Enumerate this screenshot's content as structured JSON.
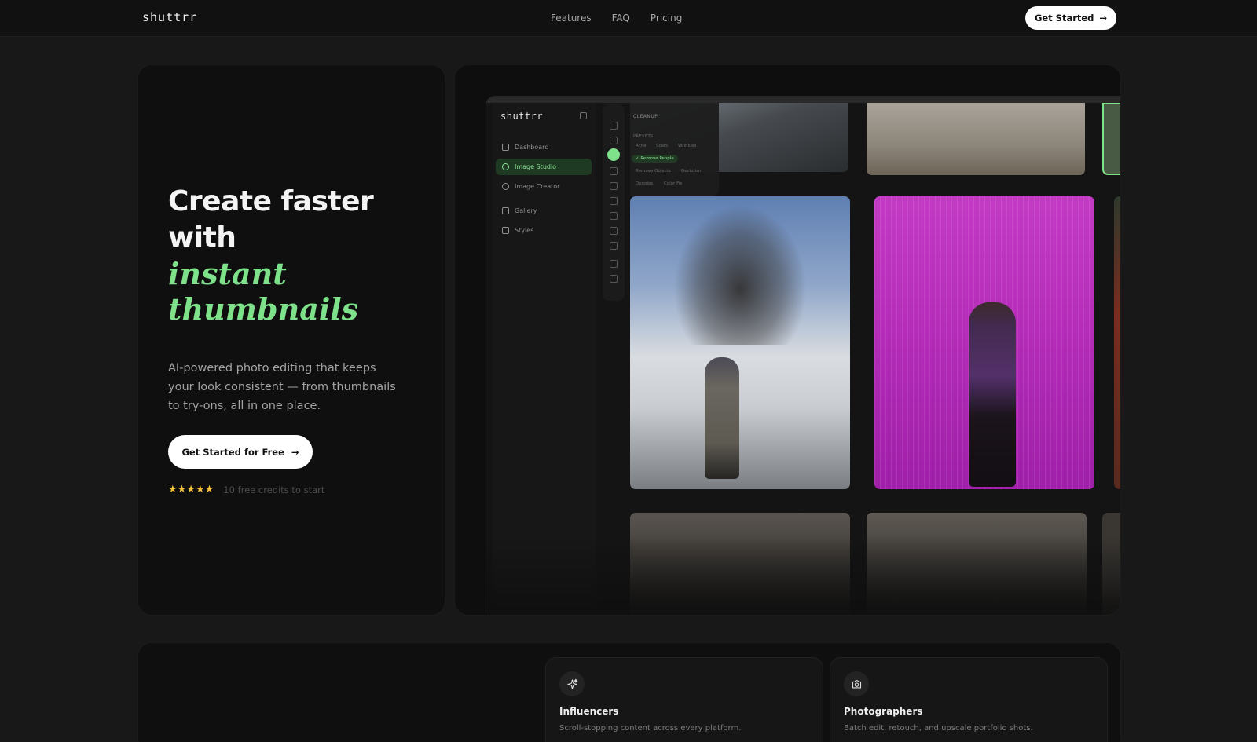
{
  "header": {
    "logo": "shuttrr",
    "nav": [
      "Features",
      "FAQ",
      "Pricing"
    ],
    "cta": "Get Started"
  },
  "hero": {
    "title": "Create faster with",
    "accent": "instant thumbnails",
    "subtitle": "AI-powered photo editing that keeps your look consistent — from thumbnails to try-ons, all in one place.",
    "cta": "Get Started for Free",
    "stars": "★★★★★",
    "credits": "10 free credits to start"
  },
  "app": {
    "logo": "shuttrr",
    "nav": [
      {
        "label": "Dashboard"
      },
      {
        "label": "Image Studio",
        "active": true
      },
      {
        "label": "Image Creator"
      },
      {
        "label": "Gallery"
      },
      {
        "label": "Styles"
      }
    ],
    "panel": {
      "heading": "CLEANUP",
      "presets_label": "PRESETS",
      "chips": [
        "Acne",
        "Scars",
        "Wrinkles",
        "✓ Remove People",
        "Remove Objects",
        "Declutter",
        "Denoise",
        "Color Fix"
      ]
    }
  },
  "features": [
    {
      "icon": "sparkle-icon",
      "title": "Influencers",
      "desc": "Scroll-stopping content across every platform."
    },
    {
      "icon": "camera-icon",
      "title": "Photographers",
      "desc": "Batch edit, retouch, and upscale portfolio shots."
    }
  ],
  "colors": {
    "accent": "#7ee28a",
    "background": "#181818",
    "star": "#f5c13b"
  }
}
